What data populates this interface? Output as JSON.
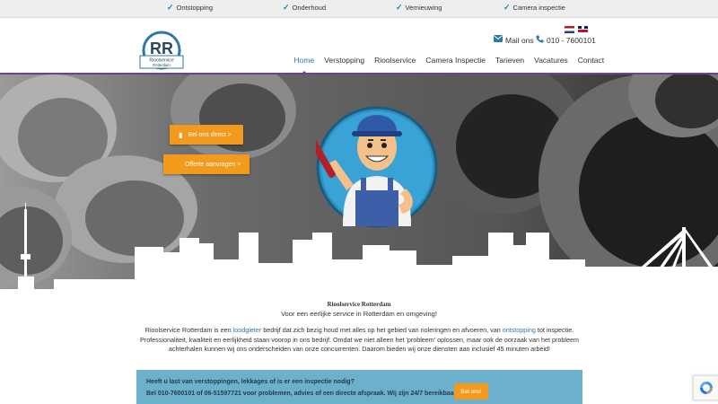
{
  "usp_bar": {
    "items": [
      {
        "label": "Ontstopping"
      },
      {
        "label": "Onderhoud"
      },
      {
        "label": "Vernieuwing"
      },
      {
        "label": "Camera inspectie"
      }
    ]
  },
  "header": {
    "logo": {
      "monogram": "RR",
      "line1": "Rioolservice",
      "line2": "Rotterdam"
    },
    "languages": [
      "nl",
      "en"
    ],
    "mail_label": "Mail ons",
    "phone_label": "010 - 7600101"
  },
  "nav": {
    "items": [
      {
        "label": "Home",
        "active": true
      },
      {
        "label": "Verstopping"
      },
      {
        "label": "Rioolservice"
      },
      {
        "label": "Camera Inspectie"
      },
      {
        "label": "Tarieven"
      },
      {
        "label": "Vacatures"
      },
      {
        "label": "Contact"
      }
    ]
  },
  "hero": {
    "call_button": "Bel ons direct >",
    "quote_button": "Offerte aanvragen >"
  },
  "content": {
    "title": "Rioolservice Rotterdam",
    "subtitle": "Voor een eerlijke service in Rotterdam en omgeving!",
    "p_part1": "Rioolservice Rotterdam is een ",
    "p_link1": "loodgieter",
    "p_part2": " bedrijf dat zich bezig houd met alles op het gebied van rioleringen en afvoeren, van ",
    "p_link2": "ontstopping",
    "p_part3": " tot inspectie. Professionaliteit, kwaliteit en eerlijkheid staan voorop in ons bedrijf. Omdat we niet alleen het 'probleem' oplossen, maar ook de oorzaak van het probleem achterhalen kunnen wij ons onderscheiden van onze concurrenten. Daarom bieden wij onze diensten aan inclusief 45 minuten arbeid!"
  },
  "callout": {
    "line1": "Heeft u last van verstoppingen, lekkages of is er een inspectie nodig?",
    "line2": "Bel 010-7600101 of 06-51597721 voor problemen, advies of een directe afspraak. Wij zijn 24/7 bereikbaar!",
    "button": "Bel ons!"
  },
  "colors": {
    "accent": "#2c7aa8",
    "purple": "#6b3fa0",
    "orange": "#f39a1c",
    "callout_bg": "#6cb1cc"
  },
  "icons": [
    "check-icon",
    "envelope-icon",
    "phone-icon",
    "mobile-icon",
    "recaptcha-icon"
  ]
}
